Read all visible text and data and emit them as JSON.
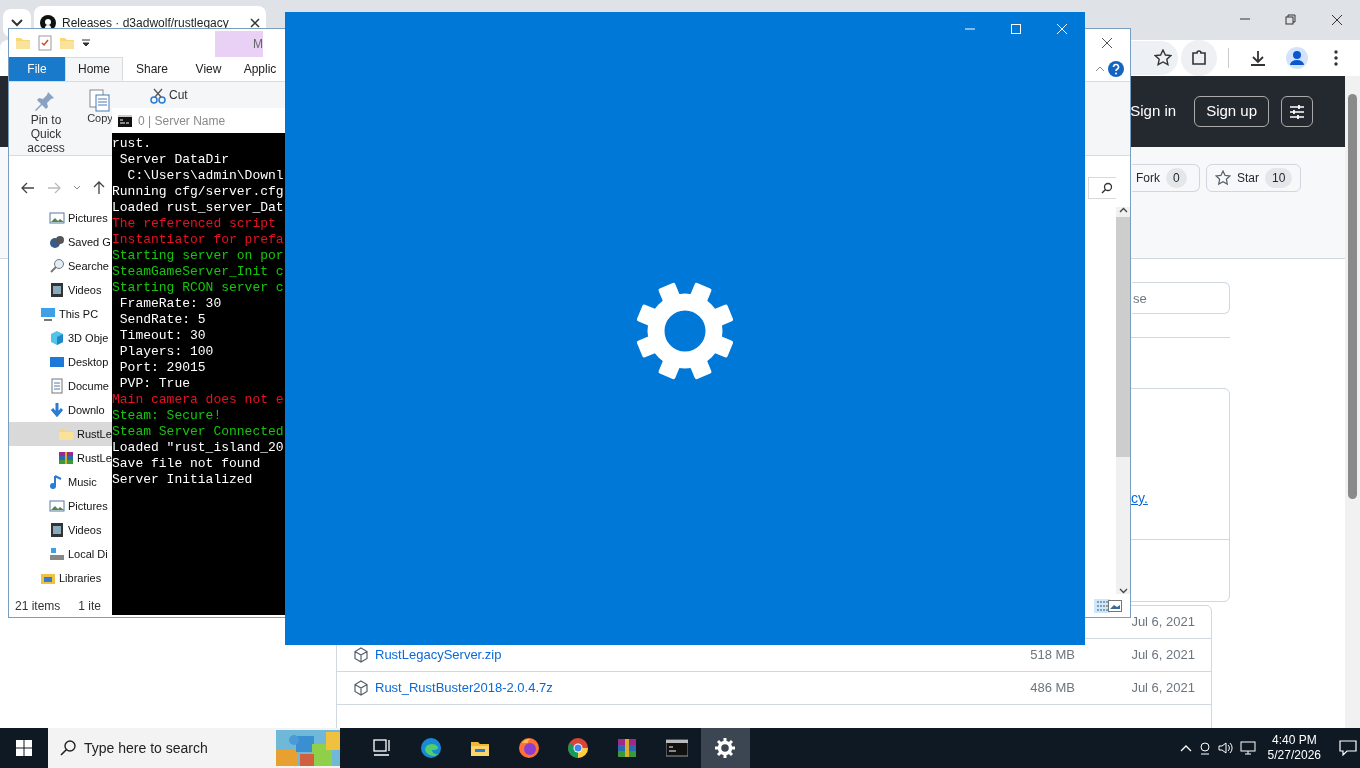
{
  "browser": {
    "tab_title": "Releases · d3adwolf/rustlegacy",
    "header": {
      "sign_in": "Sign in",
      "sign_up": "Sign up"
    },
    "repo_actions": [
      {
        "kind": "fork",
        "label": "Fork",
        "count": "0"
      },
      {
        "kind": "star",
        "label": "Star",
        "count": "10"
      }
    ],
    "search_field": {
      "placeholder": "se"
    },
    "link_fragment": "cy.",
    "assets": [
      {
        "date": "Jul 6, 2021"
      },
      {
        "name": "RustLegacyServer.zip",
        "size": "518 MB",
        "date": "Jul 6, 2021"
      },
      {
        "name": "Rust_RustBuster2018-2.0.4.7z",
        "size": "486 MB",
        "date": "Jul 6, 2021"
      }
    ]
  },
  "explorer": {
    "context_tab": "M",
    "ribbon_tabs": [
      {
        "label": "File",
        "kind": "file",
        "selected": false
      },
      {
        "label": "Home",
        "kind": "tab",
        "selected": true
      },
      {
        "label": "Share",
        "kind": "tab",
        "selected": false
      },
      {
        "label": "View",
        "kind": "tab",
        "selected": false
      },
      {
        "label": "Applic",
        "kind": "tab",
        "selected": false
      }
    ],
    "ribbon_commands": [
      {
        "label": "Pin to Quick access",
        "kind": "pin"
      },
      {
        "label": "Copy",
        "kind": "copy"
      },
      {
        "label": "Cut",
        "kind": "cut"
      }
    ],
    "nav_pane": {
      "leading_items": [
        {
          "label": "Pictures",
          "kind": "pictures",
          "selected": false
        },
        {
          "label": "Saved G",
          "kind": "games",
          "selected": false
        },
        {
          "label": "Searche",
          "kind": "searches",
          "selected": false
        },
        {
          "label": "Videos",
          "kind": "videos",
          "selected": false
        }
      ],
      "tree": [
        {
          "label": "This PC",
          "kind": "computer",
          "selected": false,
          "children": [
            {
              "label": "3D Obje",
              "kind": "objects",
              "selected": false
            },
            {
              "label": "Desktop",
              "kind": "desktop",
              "selected": false
            },
            {
              "label": "Docume",
              "kind": "documents",
              "selected": false
            },
            {
              "label": "Downlo",
              "kind": "downloads",
              "selected": false,
              "children": [
                {
                  "label": "RustLe",
                  "kind": "folder",
                  "selected": true
                },
                {
                  "label": "RustLe",
                  "kind": "archive",
                  "selected": false
                }
              ]
            },
            {
              "label": "Music",
              "kind": "music",
              "selected": false
            },
            {
              "label": "Pictures",
              "kind": "pictures",
              "selected": false
            },
            {
              "label": "Videos",
              "kind": "videos",
              "selected": false
            },
            {
              "label": "Local Di",
              "kind": "drive",
              "selected": false
            }
          ]
        },
        {
          "label": "Libraries",
          "kind": "libraries",
          "selected": false
        }
      ]
    },
    "status": [
      "21 items",
      "1 ite"
    ]
  },
  "console": {
    "title": "0 | Server Name",
    "lines": [
      {
        "text": "rust.",
        "color": "#ffffff"
      },
      {
        "text": " Server DataDir",
        "color": "#ffffff"
      },
      {
        "text": "  C:\\Users\\admin\\Downl",
        "color": "#ffffff"
      },
      {
        "text": "Running cfg/server.cfg",
        "color": "#ffffff"
      },
      {
        "text": "Loaded rust_server_Dat",
        "color": "#ffffff"
      },
      {
        "text": "The referenced script",
        "color": "#e81123"
      },
      {
        "text": "Instantiator for prefa",
        "color": "#e81123"
      },
      {
        "text": "Starting server on por",
        "color": "#16c60c"
      },
      {
        "text": "SteamGameServer_Init c",
        "color": "#16c60c"
      },
      {
        "text": "Starting RCON server c",
        "color": "#16c60c"
      },
      {
        "text": " FrameRate: 30",
        "color": "#ffffff"
      },
      {
        "text": " SendRate: 5",
        "color": "#ffffff"
      },
      {
        "text": " Timeout: 30",
        "color": "#ffffff"
      },
      {
        "text": " Players: 100",
        "color": "#ffffff"
      },
      {
        "text": " Port: 29015",
        "color": "#ffffff"
      },
      {
        "text": " PVP: True",
        "color": "#ffffff"
      },
      {
        "text": "Main camera does not e",
        "color": "#e81123"
      },
      {
        "text": "Steam: Secure!",
        "color": "#16c60c"
      },
      {
        "text": "Steam Server Connected",
        "color": "#16c60c"
      },
      {
        "text": "Loaded \"rust_island_20",
        "color": "#ffffff"
      },
      {
        "text": "Save file not found",
        "color": "#ffffff"
      },
      {
        "text": "Server Initialized",
        "color": "#ffffff"
      }
    ]
  },
  "taskbar": {
    "search": {
      "placeholder": "Type here to search"
    },
    "apps": [
      {
        "kind": "taskview",
        "active": false
      },
      {
        "kind": "edge",
        "active": false
      },
      {
        "kind": "explorer",
        "active": false
      },
      {
        "kind": "firefox",
        "active": false
      },
      {
        "kind": "chrome",
        "active": false
      },
      {
        "kind": "winrar",
        "active": false
      },
      {
        "kind": "terminal",
        "active": false
      },
      {
        "kind": "settings",
        "active": true
      }
    ],
    "time": "4:40 PM",
    "date": "5/27/2026"
  }
}
